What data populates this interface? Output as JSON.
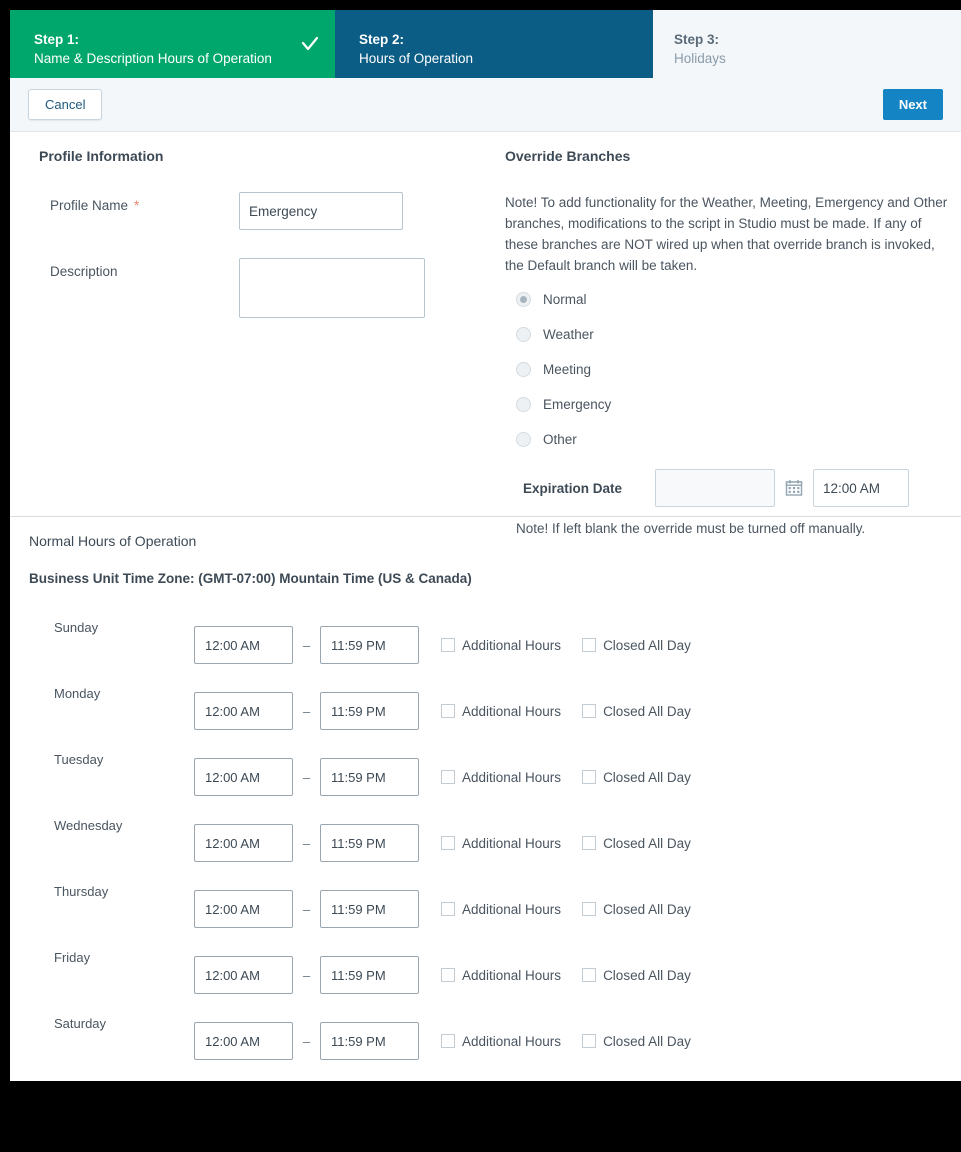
{
  "wizard": {
    "steps": [
      {
        "num": "Step 1:",
        "label": "Name & Description Hours of Operation",
        "state": "complete",
        "icon": "check-icon"
      },
      {
        "num": "Step 2:",
        "label": "Hours of Operation",
        "state": "active"
      },
      {
        "num": "Step 3:",
        "label": "Holidays",
        "state": "upcoming"
      }
    ]
  },
  "toolbar": {
    "cancel_label": "Cancel",
    "next_label": "Next"
  },
  "profile": {
    "section_title": "Profile Information",
    "name_label": "Profile Name",
    "required_marker": "*",
    "name_value": "Emergency",
    "description_label": "Description",
    "description_value": ""
  },
  "override": {
    "section_title": "Override Branches",
    "note": "Note! To add functionality for the Weather, Meeting, Emergency and Other branches, modifications to the script in Studio must be made. If any of these branches are NOT wired up when that override branch is invoked, the Default branch will be taken.",
    "branches": [
      {
        "label": "Normal",
        "selected": true
      },
      {
        "label": "Weather",
        "selected": false
      },
      {
        "label": "Meeting",
        "selected": false
      },
      {
        "label": "Emergency",
        "selected": false
      },
      {
        "label": "Other",
        "selected": false
      }
    ],
    "expiration_label": "Expiration Date",
    "expiration_date_value": "",
    "expiration_time_value": "12:00 AM",
    "calendar_icon": "calendar-icon",
    "expiration_note": "Note! If left blank the override must be turned off manually."
  },
  "hours": {
    "title": "Normal Hours of Operation",
    "timezone_line": "Business Unit Time Zone: (GMT-07:00) Mountain Time (US & Canada)",
    "range_separator": "–",
    "additional_hours_label": "Additional Hours",
    "closed_all_day_label": "Closed All Day",
    "days": [
      {
        "name": "Sunday",
        "start": "12:00 AM",
        "end": "11:59 PM",
        "additional": false,
        "closed": false
      },
      {
        "name": "Monday",
        "start": "12:00 AM",
        "end": "11:59 PM",
        "additional": false,
        "closed": false
      },
      {
        "name": "Tuesday",
        "start": "12:00 AM",
        "end": "11:59 PM",
        "additional": false,
        "closed": false
      },
      {
        "name": "Wednesday",
        "start": "12:00 AM",
        "end": "11:59 PM",
        "additional": false,
        "closed": false
      },
      {
        "name": "Thursday",
        "start": "12:00 AM",
        "end": "11:59 PM",
        "additional": false,
        "closed": false
      },
      {
        "name": "Friday",
        "start": "12:00 AM",
        "end": "11:59 PM",
        "additional": false,
        "closed": false
      },
      {
        "name": "Saturday",
        "start": "12:00 AM",
        "end": "11:59 PM",
        "additional": false,
        "closed": false
      }
    ]
  },
  "colors": {
    "step_complete": "#00a76d",
    "step_active": "#0b5d86",
    "step_upcoming_bg": "#f3f7fa",
    "primary_button": "#1484c4",
    "required_marker": "#e8836a"
  }
}
